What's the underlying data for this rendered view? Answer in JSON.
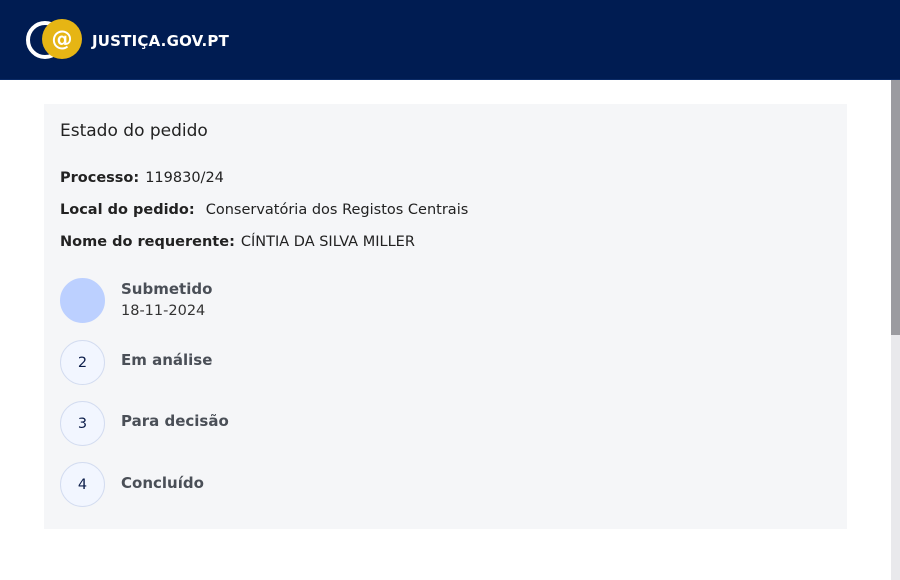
{
  "header": {
    "logo_text": "JUSTIÇA.GOV.PT",
    "logo_icon": "justica-at-logo-icon",
    "background_color": "#001c52",
    "accent_color": "#e6b514"
  },
  "card": {
    "title": "Estado do pedido",
    "fields": [
      {
        "label": "Processo:",
        "value": "119830/24"
      },
      {
        "label": "Local do pedido:",
        "value": "Conservatória dos Registos Centrais"
      },
      {
        "label": "Nome do requerente:",
        "value": "CÍNTIA DA SILVA MILLER"
      }
    ]
  },
  "steps": [
    {
      "number": "",
      "title": "Submetido",
      "date": "18-11-2024",
      "state": "done"
    },
    {
      "number": "2",
      "title": "Em análise",
      "date": "",
      "state": "pending"
    },
    {
      "number": "3",
      "title": "Para decisão",
      "date": "",
      "state": "pending"
    },
    {
      "number": "4",
      "title": "Concluído",
      "date": "",
      "state": "pending"
    }
  ]
}
